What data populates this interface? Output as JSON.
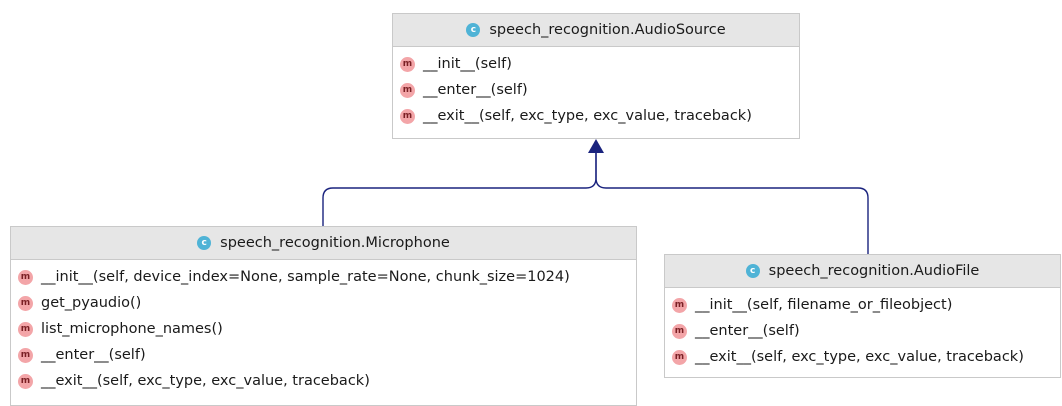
{
  "classes": {
    "audio_source": {
      "badge": "c",
      "name": "speech_recognition.AudioSource",
      "members": [
        {
          "badge": "m",
          "signature": "__init__(self)"
        },
        {
          "badge": "m",
          "signature": "__enter__(self)"
        },
        {
          "badge": "m",
          "signature": "__exit__(self, exc_type, exc_value, traceback)"
        }
      ]
    },
    "microphone": {
      "badge": "c",
      "name": "speech_recognition.Microphone",
      "members": [
        {
          "badge": "m",
          "signature": "__init__(self, device_index=None, sample_rate=None, chunk_size=1024)"
        },
        {
          "badge": "m",
          "signature": "get_pyaudio()"
        },
        {
          "badge": "m",
          "signature": "list_microphone_names()"
        },
        {
          "badge": "m",
          "signature": "__enter__(self)"
        },
        {
          "badge": "m",
          "signature": "__exit__(self, exc_type, exc_value, traceback)"
        }
      ]
    },
    "audio_file": {
      "badge": "c",
      "name": "speech_recognition.AudioFile",
      "members": [
        {
          "badge": "m",
          "signature": "__init__(self, filename_or_fileobject)"
        },
        {
          "badge": "m",
          "signature": "__enter__(self)"
        },
        {
          "badge": "m",
          "signature": "__exit__(self, exc_type, exc_value, traceback)"
        }
      ]
    }
  },
  "relations": [
    {
      "from": "speech_recognition.Microphone",
      "to": "speech_recognition.AudioSource",
      "kind": "inheritance"
    },
    {
      "from": "speech_recognition.AudioFile",
      "to": "speech_recognition.AudioSource",
      "kind": "inheritance"
    }
  ],
  "colors": {
    "edge": "#1a237e",
    "class_badge": "#4fb3d6",
    "method_badge": "#f3a5a8",
    "header_bg": "#e6e6e6"
  }
}
